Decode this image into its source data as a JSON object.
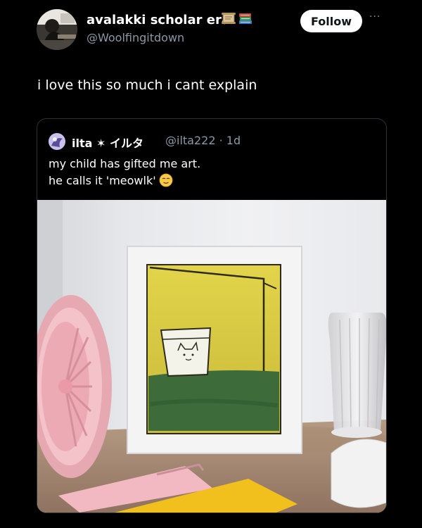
{
  "post": {
    "display_name": "avalakki scholar era",
    "handle": "@Woolfingitdown",
    "follow_label": "Follow",
    "more_label": "···",
    "text": "i love this so much i cant explain",
    "badges": [
      "scroll-icon",
      "books-icon"
    ]
  },
  "quote": {
    "name": "ilta ✶ イルタ",
    "handle": "@ilta222",
    "time": "1d",
    "meta": "@ilta222 · 1d",
    "line1": "my child has gifted me art.",
    "line2": "he calls it 'meowlk'",
    "emoji": "relieved-face-emoji"
  },
  "colors": {
    "follow_bg": "#ffffff",
    "handle_gray": "#8b98a5",
    "card_border": "#2f3336"
  }
}
